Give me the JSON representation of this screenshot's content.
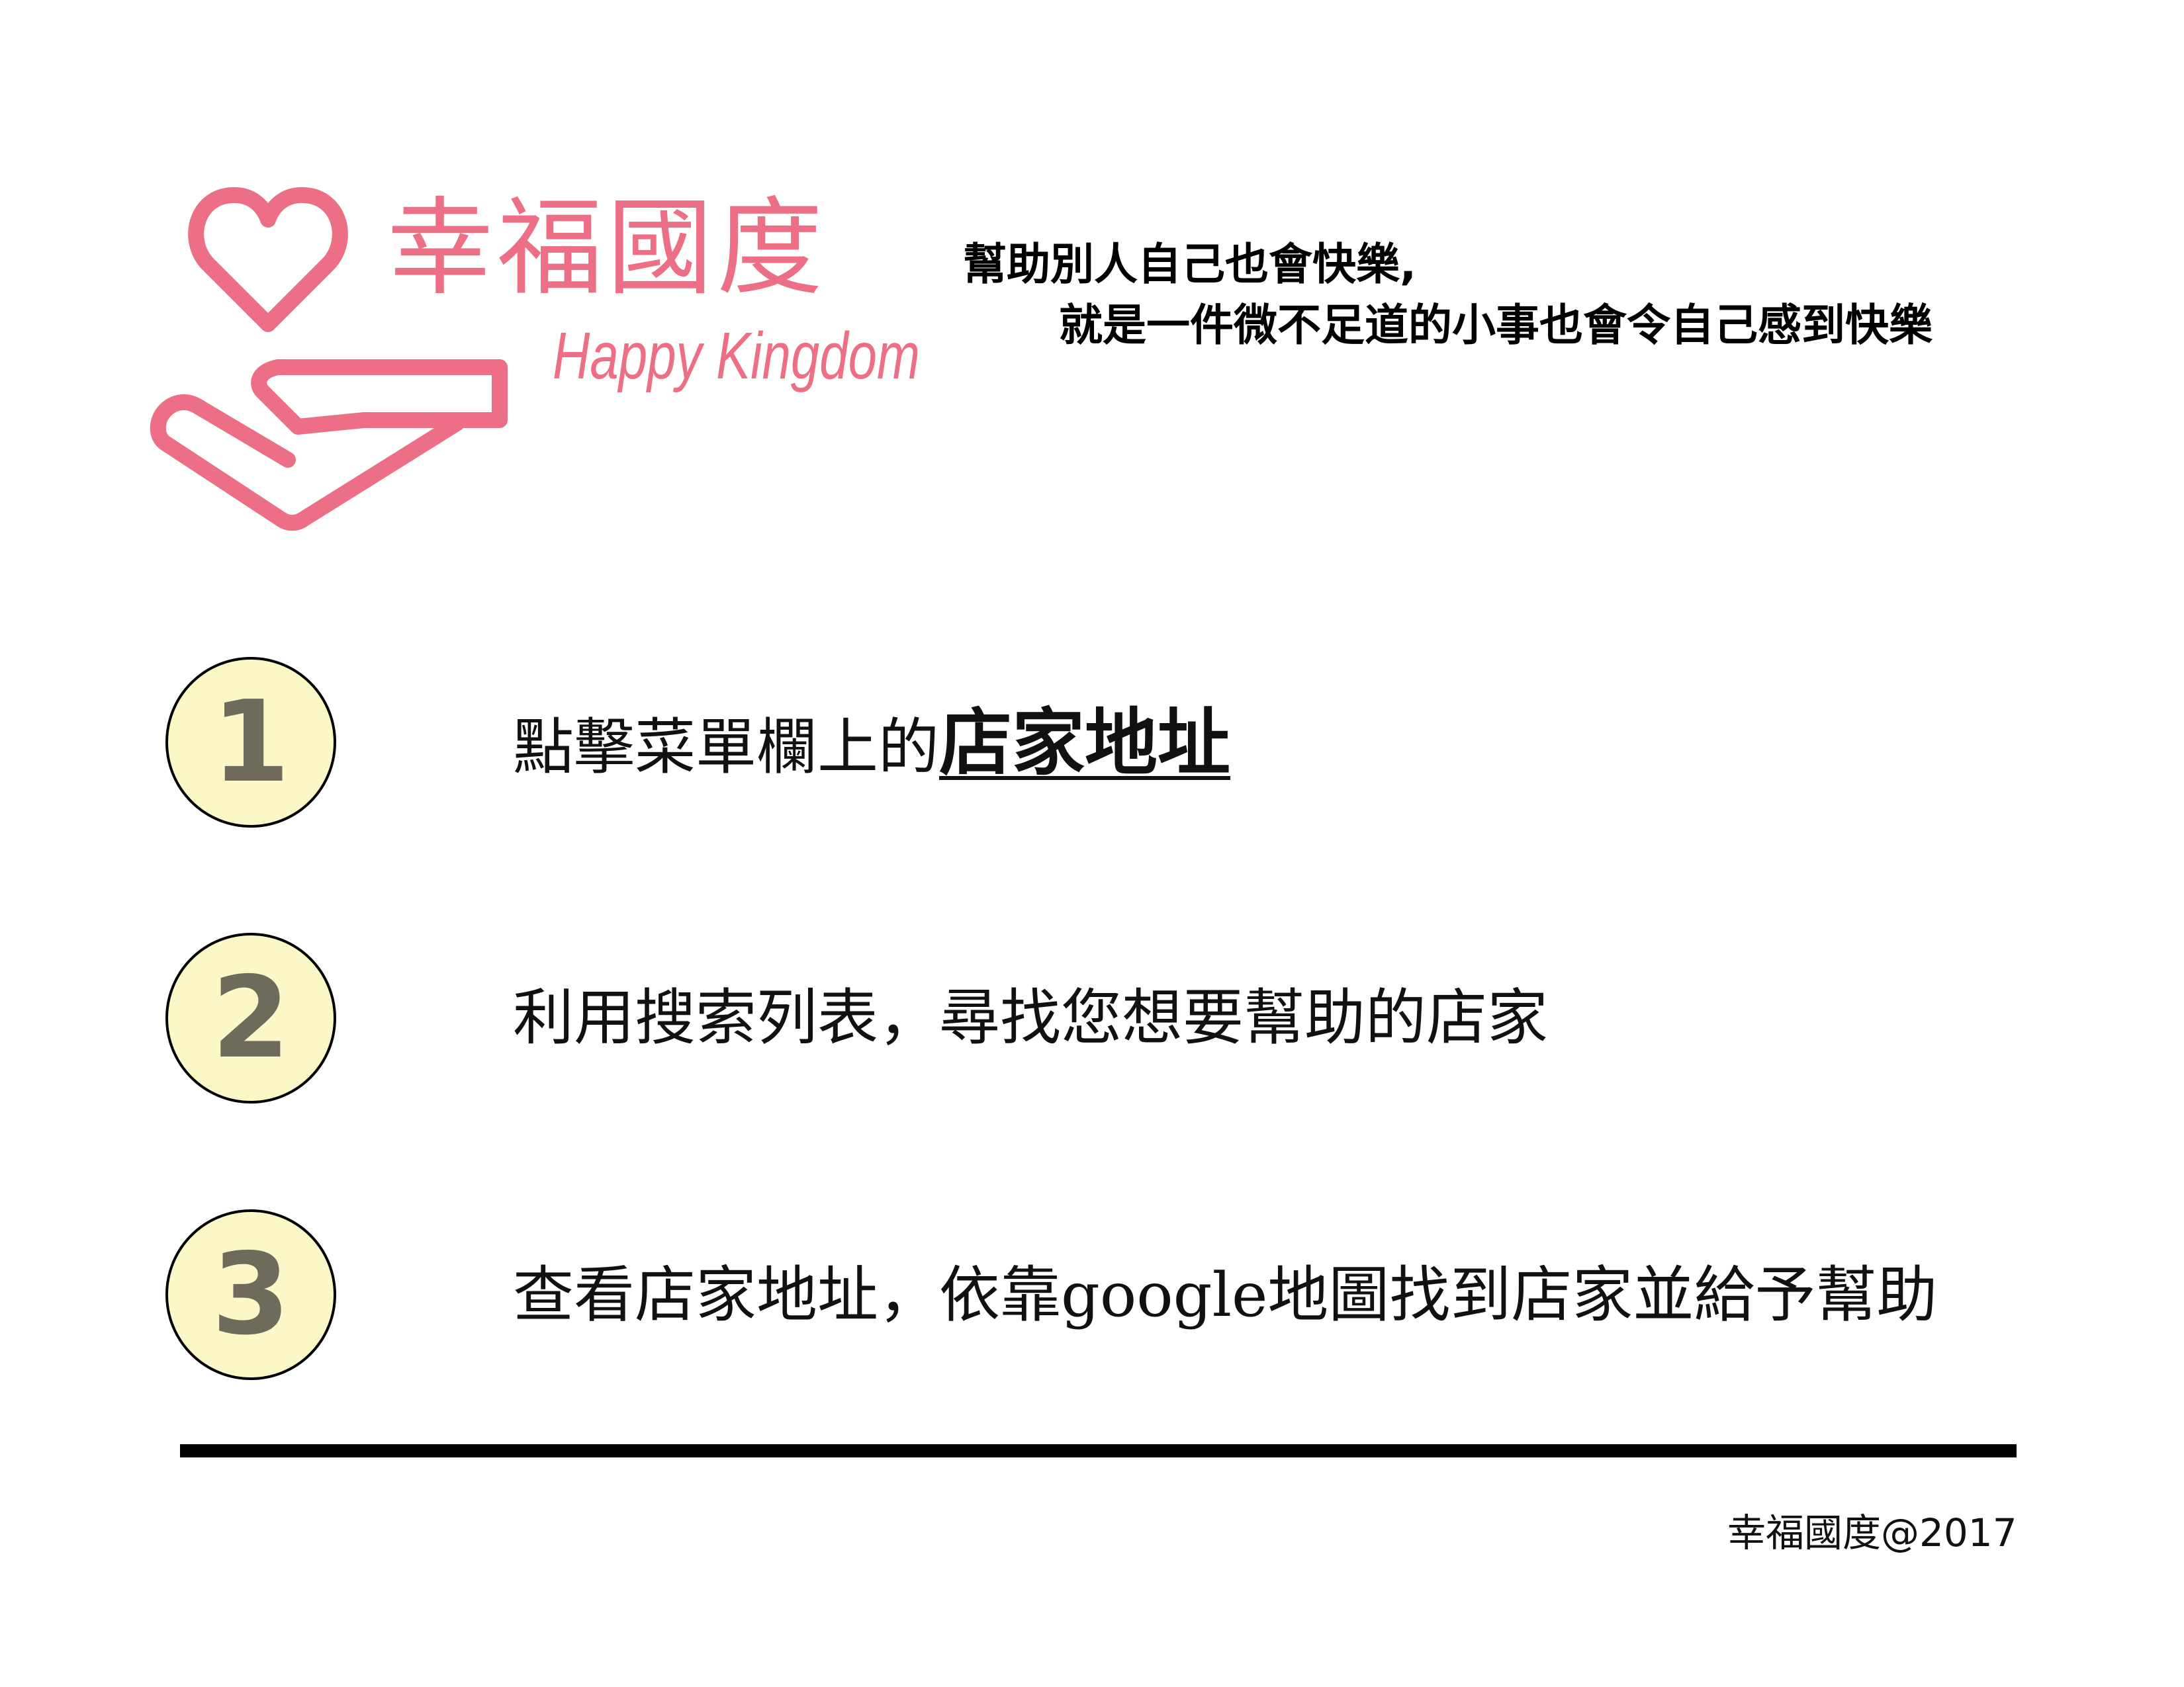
{
  "brand": {
    "name_zh": "幸福國度",
    "name_en": "Happy Kingdom",
    "color": "#ec6f85",
    "logo_icon": "heart-in-hand-icon"
  },
  "slogan": {
    "line1": "幫助別人自己也會快樂,",
    "line2": "就是一件微不足道的小事也會令自己感到快樂"
  },
  "steps": [
    {
      "number": "1",
      "text": "點擊菜單欄上的",
      "highlight": "店家地址"
    },
    {
      "number": "2",
      "text": "利用搜索列表，尋找您想要幫助的店家"
    },
    {
      "number": "3",
      "text": "查看店家地址，依靠google地圖找到店家並給予幫助"
    }
  ],
  "step_circle_color": "#fbf7c6",
  "footer": {
    "copyright": "幸福國度@2017"
  }
}
